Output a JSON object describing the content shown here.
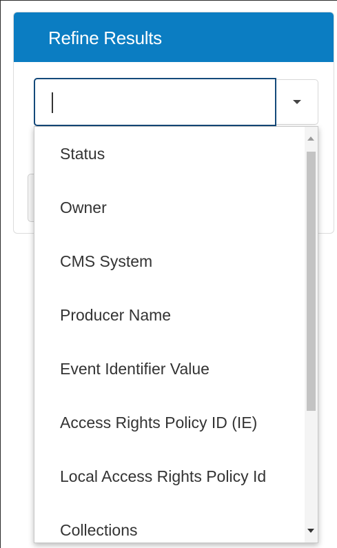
{
  "panel": {
    "title": "Refine Results"
  },
  "combobox": {
    "value": "",
    "toggle_icon": "chevron-down-icon"
  },
  "dropdown": {
    "options": [
      "Status",
      "Owner",
      "CMS System",
      "Producer Name",
      "Event Identifier Value",
      "Access Rights Policy ID (IE)",
      "Local Access Rights Policy Id",
      "Collections"
    ],
    "scroll_position": 0.0
  },
  "colors": {
    "header": "#0b7dc2",
    "input_border": "#13497a",
    "text": "#333333"
  }
}
